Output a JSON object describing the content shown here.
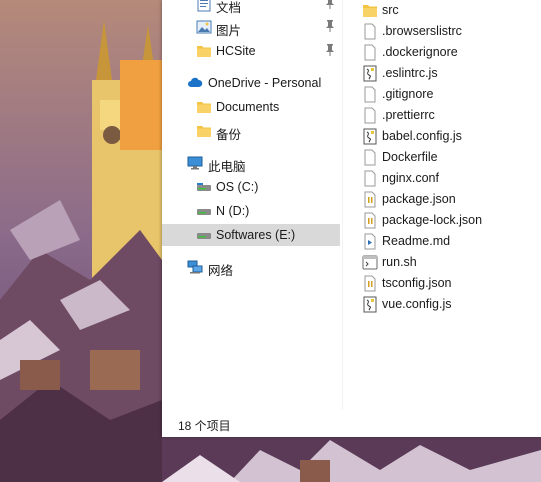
{
  "nav": {
    "quick_access": [
      {
        "label": "文档",
        "icon": "document-folder-icon",
        "pinned": true
      },
      {
        "label": "图片",
        "icon": "pictures-folder-icon",
        "pinned": true
      },
      {
        "label": "HCSite",
        "icon": "folder-icon",
        "pinned": true
      }
    ],
    "onedrive": {
      "label": "OneDrive - Personal",
      "icon": "onedrive-cloud-icon"
    },
    "onedrive_children": [
      {
        "label": "Documents",
        "icon": "folder-icon"
      },
      {
        "label": "备份",
        "icon": "folder-icon"
      }
    ],
    "this_pc": {
      "label": "此电脑",
      "icon": "computer-icon"
    },
    "drives": [
      {
        "label": "OS (C:)",
        "icon": "drive-icon"
      },
      {
        "label": "N (D:)",
        "icon": "drive-icon"
      },
      {
        "label": "Softwares (E:)",
        "icon": "drive-icon",
        "selected": true
      }
    ],
    "network": {
      "label": "网络",
      "icon": "network-icon"
    }
  },
  "files": [
    {
      "name": "src",
      "icon": "folder-icon"
    },
    {
      "name": ".browserslistrc",
      "icon": "file-icon"
    },
    {
      "name": ".dockerignore",
      "icon": "file-icon"
    },
    {
      "name": ".eslintrc.js",
      "icon": "js-file-icon"
    },
    {
      "name": ".gitignore",
      "icon": "file-icon"
    },
    {
      "name": ".prettierrc",
      "icon": "file-icon"
    },
    {
      "name": "babel.config.js",
      "icon": "js-file-icon"
    },
    {
      "name": "Dockerfile",
      "icon": "file-icon"
    },
    {
      "name": "nginx.conf",
      "icon": "file-icon"
    },
    {
      "name": "package.json",
      "icon": "json-file-icon"
    },
    {
      "name": "package-lock.json",
      "icon": "json-file-icon"
    },
    {
      "name": "Readme.md",
      "icon": "markdown-file-icon"
    },
    {
      "name": "run.sh",
      "icon": "shell-script-icon"
    },
    {
      "name": "tsconfig.json",
      "icon": "json-file-icon"
    },
    {
      "name": "vue.config.js",
      "icon": "js-file-icon"
    }
  ],
  "status": {
    "item_count": "18 个项目"
  },
  "colors": {
    "folder": "#f4c443",
    "selection": "#d9d9d9",
    "onedrive": "#1a73c8"
  }
}
